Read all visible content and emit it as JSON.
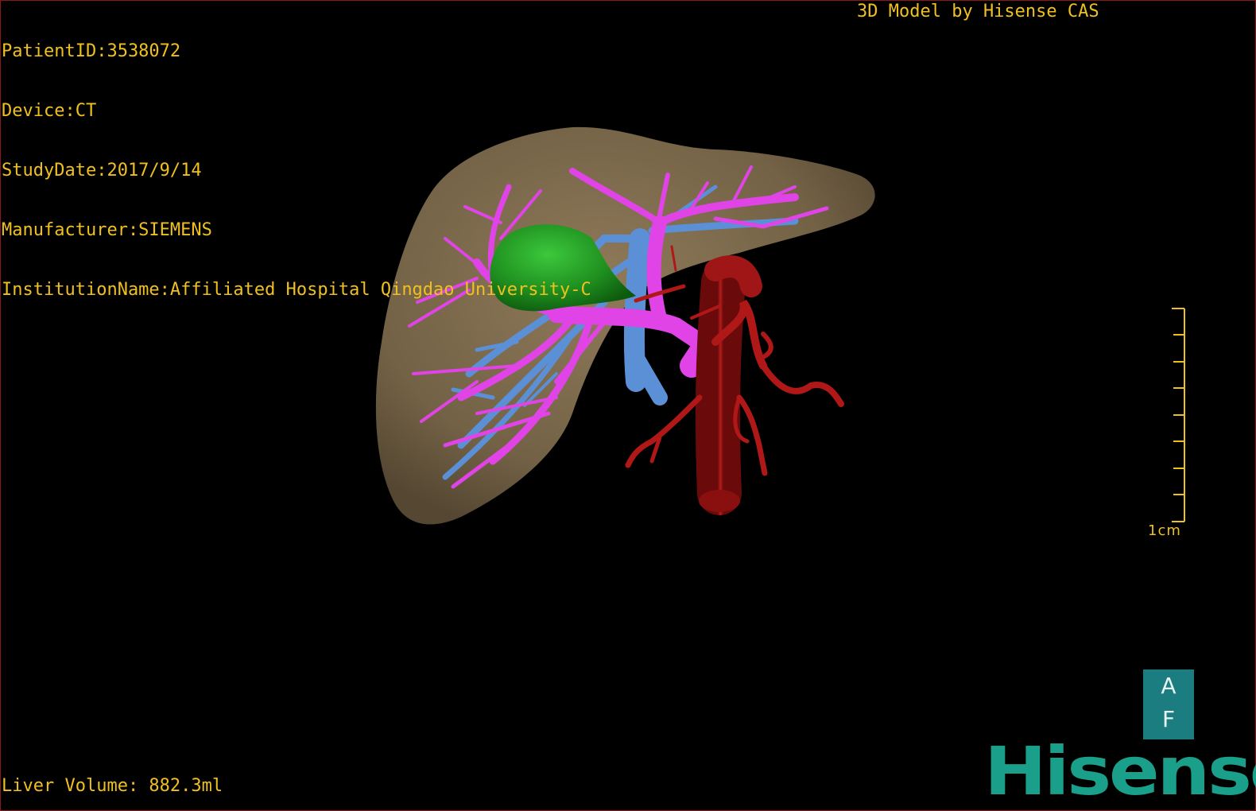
{
  "header": {
    "patient_id": "PatientID:3538072",
    "device": "Device:CT",
    "study_date": "StudyDate:2017/9/14",
    "manufacturer": "Manufacturer:SIEMENS",
    "institution": "InstitutionName:Affiliated Hospital Qingdao University-C"
  },
  "credit": "3D Model by Hisense CAS",
  "footer": {
    "liver_volume": "Liver Volume: 882.3ml"
  },
  "scale_bar": {
    "label": "1cm"
  },
  "orientation": {
    "top": "A",
    "bottom": "F"
  },
  "logo": "Hisense",
  "colors": {
    "overlay_text": "#f0c020",
    "liver": "#8a7556",
    "portal_vein": "#e044e6",
    "hepatic_vein": "#5b8fd6",
    "artery": "#b01818",
    "gallbladder": "#1f8f1f",
    "orientation_cube": "#1b7d7f",
    "logo": "#1aa08a"
  }
}
